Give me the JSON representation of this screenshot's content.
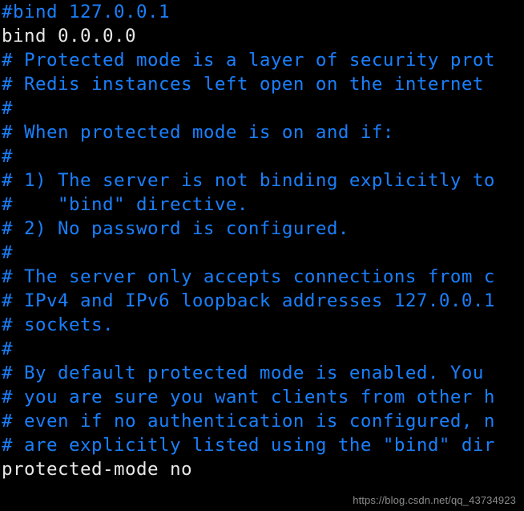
{
  "terminal": {
    "background_color": "#000000",
    "comment_color": "#1a7ffb",
    "config_color": "#e8e8e8",
    "file_kind": "redis-config",
    "lines": [
      {
        "id": "line-1",
        "kind": "comment",
        "text": "#bind 127.0.0.1"
      },
      {
        "id": "line-2",
        "kind": "config",
        "text": "bind 0.0.0.0"
      },
      {
        "id": "line-3",
        "kind": "comment",
        "text": "# Protected mode is a layer of security prot"
      },
      {
        "id": "line-4",
        "kind": "comment",
        "text": "# Redis instances left open on the internet"
      },
      {
        "id": "line-5",
        "kind": "comment",
        "text": "#"
      },
      {
        "id": "line-6",
        "kind": "comment",
        "text": "# When protected mode is on and if:"
      },
      {
        "id": "line-7",
        "kind": "comment",
        "text": "#"
      },
      {
        "id": "line-8",
        "kind": "comment",
        "text": "# 1) The server is not binding explicitly to"
      },
      {
        "id": "line-9",
        "kind": "comment",
        "text": "#    \"bind\" directive."
      },
      {
        "id": "line-10",
        "kind": "comment",
        "text": "# 2) No password is configured."
      },
      {
        "id": "line-11",
        "kind": "comment",
        "text": "#"
      },
      {
        "id": "line-12",
        "kind": "comment",
        "text": "# The server only accepts connections from c"
      },
      {
        "id": "line-13",
        "kind": "comment",
        "text": "# IPv4 and IPv6 loopback addresses 127.0.0.1"
      },
      {
        "id": "line-14",
        "kind": "comment",
        "text": "# sockets."
      },
      {
        "id": "line-15",
        "kind": "comment",
        "text": "#"
      },
      {
        "id": "line-16",
        "kind": "comment",
        "text": "# By default protected mode is enabled. You "
      },
      {
        "id": "line-17",
        "kind": "comment",
        "text": "# you are sure you want clients from other h"
      },
      {
        "id": "line-18",
        "kind": "comment",
        "text": "# even if no authentication is configured, n"
      },
      {
        "id": "line-19",
        "kind": "comment",
        "text": "# are explicitly listed using the \"bind\" dir"
      },
      {
        "id": "line-20",
        "kind": "config",
        "text": "protected-mode no"
      }
    ]
  },
  "watermark": {
    "text": "https://blog.csdn.net/qq_43734923",
    "color": "#8c8c8c"
  }
}
